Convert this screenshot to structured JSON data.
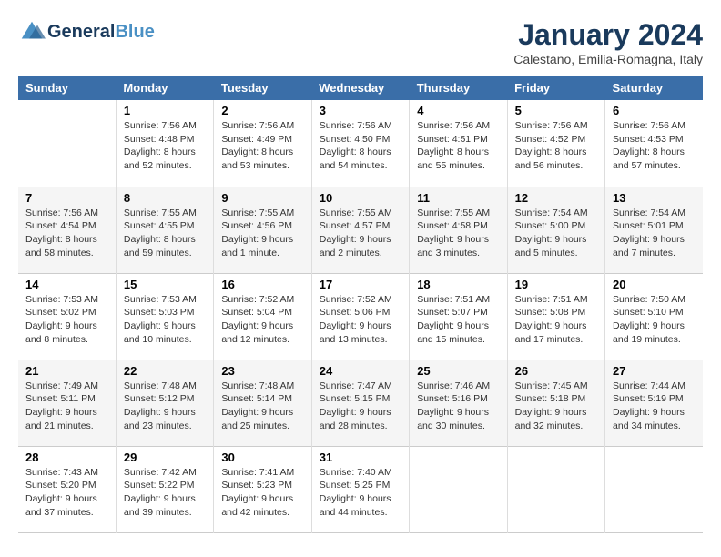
{
  "header": {
    "logo_line1": "General",
    "logo_line2": "Blue",
    "month_title": "January 2024",
    "location": "Calestano, Emilia-Romagna, Italy"
  },
  "columns": [
    "Sunday",
    "Monday",
    "Tuesday",
    "Wednesday",
    "Thursday",
    "Friday",
    "Saturday"
  ],
  "weeks": [
    [
      {
        "day": "",
        "info": ""
      },
      {
        "day": "1",
        "info": "Sunrise: 7:56 AM\nSunset: 4:48 PM\nDaylight: 8 hours\nand 52 minutes."
      },
      {
        "day": "2",
        "info": "Sunrise: 7:56 AM\nSunset: 4:49 PM\nDaylight: 8 hours\nand 53 minutes."
      },
      {
        "day": "3",
        "info": "Sunrise: 7:56 AM\nSunset: 4:50 PM\nDaylight: 8 hours\nand 54 minutes."
      },
      {
        "day": "4",
        "info": "Sunrise: 7:56 AM\nSunset: 4:51 PM\nDaylight: 8 hours\nand 55 minutes."
      },
      {
        "day": "5",
        "info": "Sunrise: 7:56 AM\nSunset: 4:52 PM\nDaylight: 8 hours\nand 56 minutes."
      },
      {
        "day": "6",
        "info": "Sunrise: 7:56 AM\nSunset: 4:53 PM\nDaylight: 8 hours\nand 57 minutes."
      }
    ],
    [
      {
        "day": "7",
        "info": "Sunrise: 7:56 AM\nSunset: 4:54 PM\nDaylight: 8 hours\nand 58 minutes."
      },
      {
        "day": "8",
        "info": "Sunrise: 7:55 AM\nSunset: 4:55 PM\nDaylight: 8 hours\nand 59 minutes."
      },
      {
        "day": "9",
        "info": "Sunrise: 7:55 AM\nSunset: 4:56 PM\nDaylight: 9 hours\nand 1 minute."
      },
      {
        "day": "10",
        "info": "Sunrise: 7:55 AM\nSunset: 4:57 PM\nDaylight: 9 hours\nand 2 minutes."
      },
      {
        "day": "11",
        "info": "Sunrise: 7:55 AM\nSunset: 4:58 PM\nDaylight: 9 hours\nand 3 minutes."
      },
      {
        "day": "12",
        "info": "Sunrise: 7:54 AM\nSunset: 5:00 PM\nDaylight: 9 hours\nand 5 minutes."
      },
      {
        "day": "13",
        "info": "Sunrise: 7:54 AM\nSunset: 5:01 PM\nDaylight: 9 hours\nand 7 minutes."
      }
    ],
    [
      {
        "day": "14",
        "info": "Sunrise: 7:53 AM\nSunset: 5:02 PM\nDaylight: 9 hours\nand 8 minutes."
      },
      {
        "day": "15",
        "info": "Sunrise: 7:53 AM\nSunset: 5:03 PM\nDaylight: 9 hours\nand 10 minutes."
      },
      {
        "day": "16",
        "info": "Sunrise: 7:52 AM\nSunset: 5:04 PM\nDaylight: 9 hours\nand 12 minutes."
      },
      {
        "day": "17",
        "info": "Sunrise: 7:52 AM\nSunset: 5:06 PM\nDaylight: 9 hours\nand 13 minutes."
      },
      {
        "day": "18",
        "info": "Sunrise: 7:51 AM\nSunset: 5:07 PM\nDaylight: 9 hours\nand 15 minutes."
      },
      {
        "day": "19",
        "info": "Sunrise: 7:51 AM\nSunset: 5:08 PM\nDaylight: 9 hours\nand 17 minutes."
      },
      {
        "day": "20",
        "info": "Sunrise: 7:50 AM\nSunset: 5:10 PM\nDaylight: 9 hours\nand 19 minutes."
      }
    ],
    [
      {
        "day": "21",
        "info": "Sunrise: 7:49 AM\nSunset: 5:11 PM\nDaylight: 9 hours\nand 21 minutes."
      },
      {
        "day": "22",
        "info": "Sunrise: 7:48 AM\nSunset: 5:12 PM\nDaylight: 9 hours\nand 23 minutes."
      },
      {
        "day": "23",
        "info": "Sunrise: 7:48 AM\nSunset: 5:14 PM\nDaylight: 9 hours\nand 25 minutes."
      },
      {
        "day": "24",
        "info": "Sunrise: 7:47 AM\nSunset: 5:15 PM\nDaylight: 9 hours\nand 28 minutes."
      },
      {
        "day": "25",
        "info": "Sunrise: 7:46 AM\nSunset: 5:16 PM\nDaylight: 9 hours\nand 30 minutes."
      },
      {
        "day": "26",
        "info": "Sunrise: 7:45 AM\nSunset: 5:18 PM\nDaylight: 9 hours\nand 32 minutes."
      },
      {
        "day": "27",
        "info": "Sunrise: 7:44 AM\nSunset: 5:19 PM\nDaylight: 9 hours\nand 34 minutes."
      }
    ],
    [
      {
        "day": "28",
        "info": "Sunrise: 7:43 AM\nSunset: 5:20 PM\nDaylight: 9 hours\nand 37 minutes."
      },
      {
        "day": "29",
        "info": "Sunrise: 7:42 AM\nSunset: 5:22 PM\nDaylight: 9 hours\nand 39 minutes."
      },
      {
        "day": "30",
        "info": "Sunrise: 7:41 AM\nSunset: 5:23 PM\nDaylight: 9 hours\nand 42 minutes."
      },
      {
        "day": "31",
        "info": "Sunrise: 7:40 AM\nSunset: 5:25 PM\nDaylight: 9 hours\nand 44 minutes."
      },
      {
        "day": "",
        "info": ""
      },
      {
        "day": "",
        "info": ""
      },
      {
        "day": "",
        "info": ""
      }
    ]
  ]
}
